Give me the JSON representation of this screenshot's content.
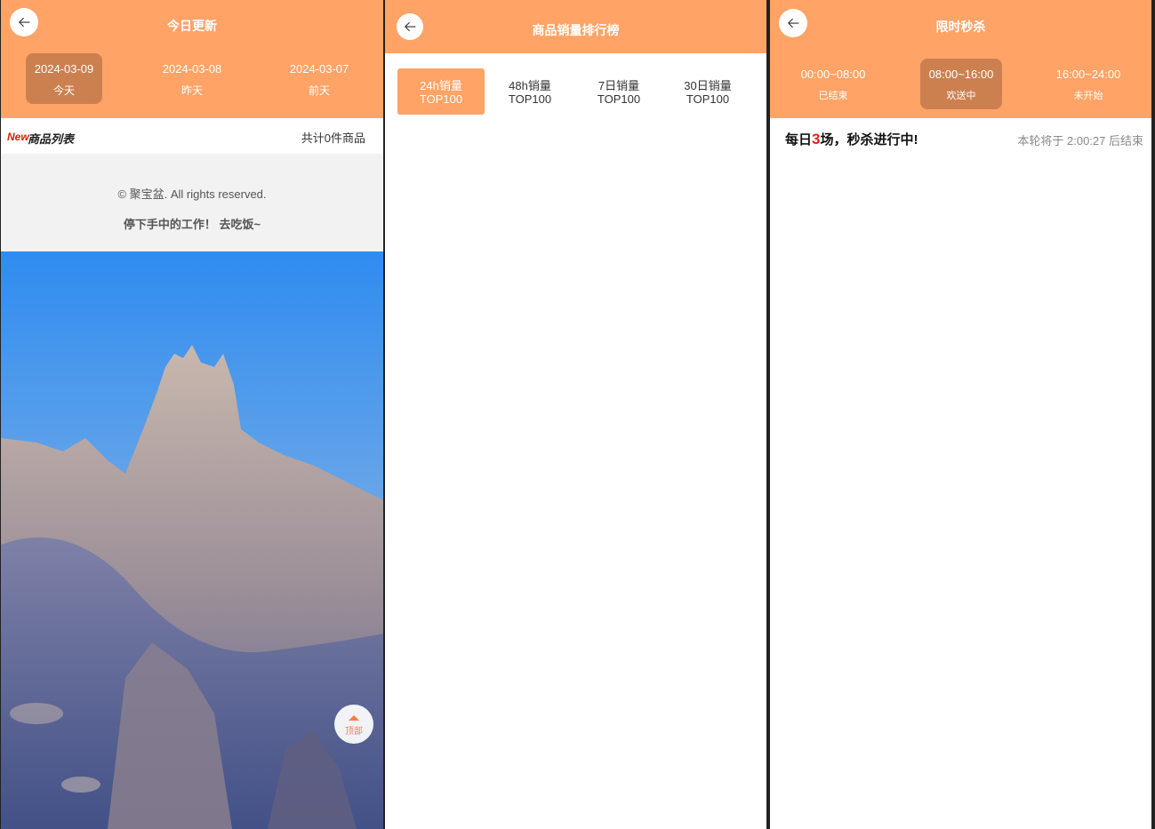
{
  "colors": {
    "accent": "#ffa366",
    "active_tab": "#cc8050",
    "highlight": "#e02020"
  },
  "today_panel": {
    "title": "今日更新",
    "back_icon": "arrow-left-icon",
    "date_tabs": [
      {
        "date": "2024-03-09",
        "label": "今天",
        "active": true
      },
      {
        "date": "2024-03-08",
        "label": "昨天",
        "active": false
      },
      {
        "date": "2024-03-07",
        "label": "前天",
        "active": false
      }
    ],
    "list_badge": "New",
    "list_title": "商品列表",
    "count_text": "共计0件商品",
    "copyright": "© 聚宝盆. All rights reserved.",
    "message": "停下手中的工作！ 去吃饭~",
    "top_button_label": "顶部"
  },
  "ranking_panel": {
    "title": "商品销量排行榜",
    "back_icon": "arrow-left-icon",
    "tabs": [
      {
        "line1": "24h销量",
        "line2": "TOP100",
        "active": true
      },
      {
        "line1": "48h销量",
        "line2": "TOP100",
        "active": false
      },
      {
        "line1": "7日销量",
        "line2": "TOP100",
        "active": false
      },
      {
        "line1": "30日销量",
        "line2": "TOP100",
        "active": false
      }
    ]
  },
  "flash_panel": {
    "title": "限时秒杀",
    "back_icon": "arrow-left-icon",
    "slots": [
      {
        "time": "00:00~08:00",
        "status": "已结束",
        "active": false
      },
      {
        "time": "08:00~16:00",
        "status": "欢送中",
        "active": true
      },
      {
        "time": "16:00~24:00",
        "status": "未开始",
        "active": false
      }
    ],
    "banner_prefix": "每日",
    "banner_num": "3",
    "banner_suffix": "场，秒杀进行中!",
    "countdown": "本轮将于 2:00:27 后结束"
  }
}
